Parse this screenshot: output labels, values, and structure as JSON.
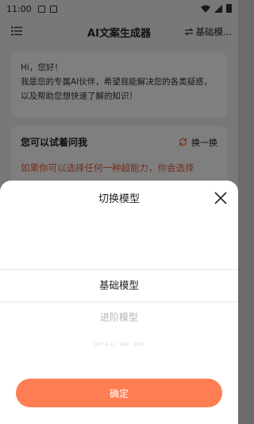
{
  "status_bar": {
    "time": "11:00"
  },
  "app_bar": {
    "title": "AI文案生成器",
    "switch_label": "基础模..."
  },
  "greeting": {
    "text": "Hi，您好！\n我是您的专属AI伙伴，希望我能解决您的各类疑惑，以及帮助您想快速了解的知识！"
  },
  "ask_card": {
    "title": "您可以试着问我",
    "refresh_label": "换一换",
    "suggestion": "如果你可以选择任何一种超能力，你会选择"
  },
  "sheet": {
    "title": "切换模型",
    "options": [
      "基础模型",
      "进阶模型",
      "GPT-4.0 · 16K · 800"
    ],
    "confirm_label": "确定"
  },
  "colors": {
    "accent": "#ff7d52",
    "suggestion": "#e8603a"
  }
}
